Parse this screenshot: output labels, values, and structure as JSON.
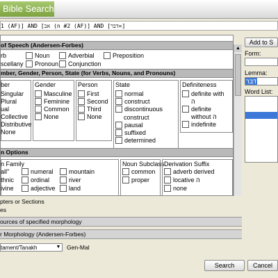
{
  "title": "Bible Search",
  "query": "1 (AF)] AND [אב (n #2 (AF)] AND [דבר=]",
  "sections": {
    "part_of_speech": "of Speech (Andersen-Forbes)",
    "number_etc": "mber, Gender, Person, State (for Verbs, Nouns, and Pronouns)",
    "noun_options": "n Options"
  },
  "pos": [
    "rb",
    "Noun",
    "Adverbial",
    "Preposition",
    "scellany",
    "Pronoun",
    "Conjunction"
  ],
  "number_group": {
    "label": "ber",
    "items": [
      "Singular",
      "Plural",
      "ual",
      "Collective",
      "Distributive",
      "None"
    ]
  },
  "gender_group": {
    "label": "Gender",
    "items": [
      "Masculine",
      "Feminine",
      "Common",
      "None"
    ]
  },
  "person_group": {
    "label": "Person",
    "items": [
      "First",
      "Second",
      "Third",
      "None"
    ]
  },
  "state_group": {
    "label": "State",
    "items": [
      "normal",
      "construct",
      "discontinuous",
      "construct",
      "pausal",
      "suffixed",
      "determined"
    ]
  },
  "definiteness_group": {
    "label": "Definiteness",
    "items": [
      "definite with",
      "ה",
      "definite",
      "without ה",
      "indefinite"
    ]
  },
  "noun_family": {
    "label": "n Family",
    "col1": [
      "all\"",
      "thnic",
      "ivine"
    ],
    "col2": [
      "numeral",
      "ordinal",
      "adjective"
    ],
    "col3": [
      "mountain",
      "river",
      "land"
    ]
  },
  "noun_subclass": {
    "label": "Noun Subclass",
    "items": [
      "common",
      "proper"
    ]
  },
  "derivation_suffix": {
    "label": "Derivation Suffix",
    "items": [
      "adverb derived",
      "locative ה",
      "none"
    ]
  },
  "rows": [
    "pters or Sections",
    "es",
    "ources of specified morphology",
    "r Morphology (Andersen-Forbes)"
  ],
  "right": {
    "add_button": "Add to S",
    "form_label": "Form:",
    "lemma_label": "Lemma:",
    "lemma_value": "דבר",
    "word_list_label": "Word List:"
  },
  "bottom": {
    "version": "tament/Tanakh",
    "range": "Gen-Mal",
    "search": "Search",
    "cancel": "Cancel"
  }
}
